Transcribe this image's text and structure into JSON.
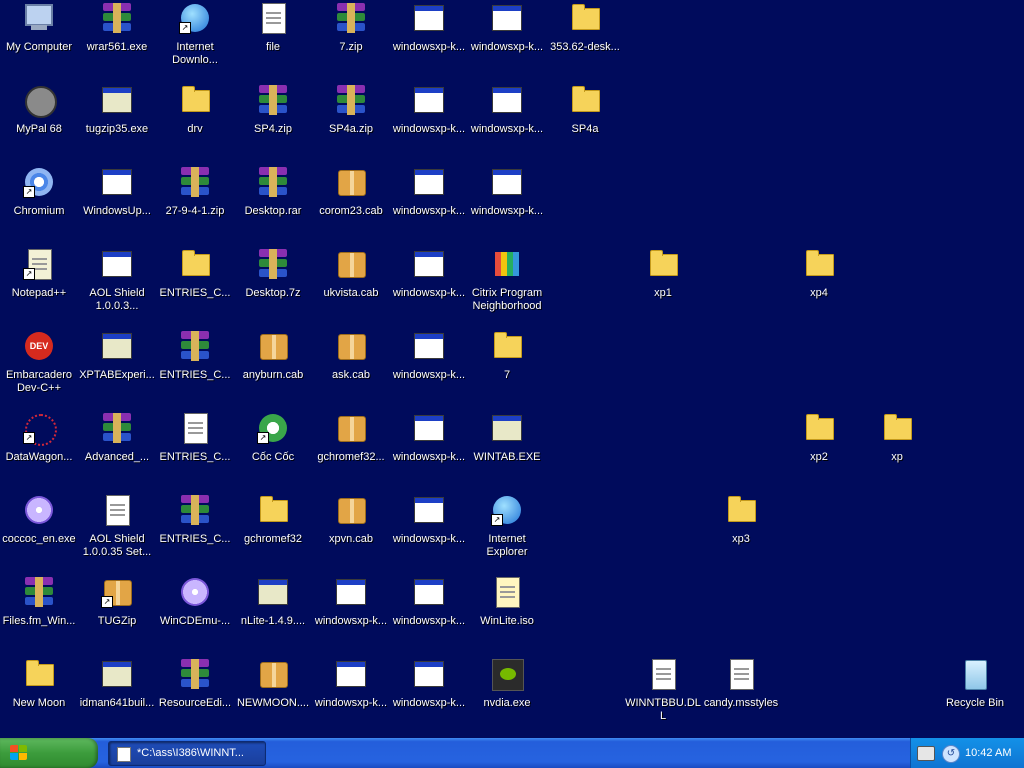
{
  "colors": {
    "desktop_bg": "#000b5c",
    "taskbar": "#245edb",
    "start_green": "#3c9c3c"
  },
  "icons": [
    {
      "label": "My Computer",
      "type": "computer",
      "col": 0,
      "row": 0
    },
    {
      "label": "wrar561.exe",
      "type": "rar",
      "col": 1,
      "row": 0
    },
    {
      "label": "Internet Downlo...",
      "type": "globe",
      "col": 2,
      "row": 0,
      "shortcut": true
    },
    {
      "label": "file",
      "type": "doc",
      "col": 3,
      "row": 0
    },
    {
      "label": "7.zip",
      "type": "rar",
      "col": 4,
      "row": 0
    },
    {
      "label": "windowsxp-k...",
      "type": "window",
      "col": 5,
      "row": 0
    },
    {
      "label": "windowsxp-k...",
      "type": "window",
      "col": 6,
      "row": 0
    },
    {
      "label": "353.62-desk...",
      "type": "folder",
      "col": 7,
      "row": 0
    },
    {
      "label": "MyPal 68",
      "type": "raccoon",
      "col": 0,
      "row": 1
    },
    {
      "label": "tugzip35.exe",
      "type": "setup",
      "col": 1,
      "row": 1
    },
    {
      "label": "drv",
      "type": "folder",
      "col": 2,
      "row": 1
    },
    {
      "label": "SP4.zip",
      "type": "rar",
      "col": 3,
      "row": 1
    },
    {
      "label": "SP4a.zip",
      "type": "rar",
      "col": 4,
      "row": 1
    },
    {
      "label": "windowsxp-k...",
      "type": "window",
      "col": 5,
      "row": 1
    },
    {
      "label": "windowsxp-k...",
      "type": "window",
      "col": 6,
      "row": 1
    },
    {
      "label": "SP4a",
      "type": "folder",
      "col": 7,
      "row": 1
    },
    {
      "label": "Chromium",
      "type": "chromium",
      "col": 0,
      "row": 2,
      "shortcut": true
    },
    {
      "label": "WindowsUp...",
      "type": "window",
      "col": 1,
      "row": 2
    },
    {
      "label": "27-9-4-1.zip",
      "type": "rar",
      "col": 2,
      "row": 2
    },
    {
      "label": "Desktop.rar",
      "type": "rar",
      "col": 3,
      "row": 2
    },
    {
      "label": "corom23.cab",
      "type": "cab",
      "col": 4,
      "row": 2
    },
    {
      "label": "windowsxp-k...",
      "type": "window",
      "col": 5,
      "row": 2
    },
    {
      "label": "windowsxp-k...",
      "type": "window",
      "col": 6,
      "row": 2
    },
    {
      "label": "Notepad++",
      "type": "notepad",
      "col": 0,
      "row": 3,
      "shortcut": true
    },
    {
      "label": "AOL Shield 1.0.0.3...",
      "type": "window",
      "col": 1,
      "row": 3
    },
    {
      "label": "ENTRIES_C...",
      "type": "folder",
      "col": 2,
      "row": 3
    },
    {
      "label": "Desktop.7z",
      "type": "rar",
      "col": 3,
      "row": 3
    },
    {
      "label": "ukvista.cab",
      "type": "cab",
      "col": 4,
      "row": 3
    },
    {
      "label": "windowsxp-k...",
      "type": "window",
      "col": 5,
      "row": 3
    },
    {
      "label": "Citrix Program Neighborhood",
      "type": "citrix",
      "col": 6,
      "row": 3
    },
    {
      "label": "xp1",
      "type": "folder",
      "col": 8,
      "row": 3
    },
    {
      "label": "xp4",
      "type": "folder",
      "col": 10,
      "row": 3
    },
    {
      "label": "Embarcadero Dev-C++",
      "type": "devcpp",
      "col": 0,
      "row": 4
    },
    {
      "label": "XPTABExperi...",
      "type": "setup",
      "col": 1,
      "row": 4
    },
    {
      "label": "ENTRIES_C...",
      "type": "rar",
      "col": 2,
      "row": 4
    },
    {
      "label": "anyburn.cab",
      "type": "cab",
      "col": 3,
      "row": 4
    },
    {
      "label": "ask.cab",
      "type": "cab",
      "col": 4,
      "row": 4
    },
    {
      "label": "windowsxp-k...",
      "type": "window",
      "col": 5,
      "row": 4
    },
    {
      "label": "7",
      "type": "folder",
      "col": 6,
      "row": 4
    },
    {
      "label": "DataWagon...",
      "type": "datawagon",
      "col": 0,
      "row": 5,
      "shortcut": true
    },
    {
      "label": "Advanced_...",
      "type": "rar",
      "col": 1,
      "row": 5
    },
    {
      "label": "ENTRIES_C...",
      "type": "doc",
      "col": 2,
      "row": 5
    },
    {
      "label": "Cốc Cốc",
      "type": "coccoc",
      "col": 3,
      "row": 5,
      "shortcut": true
    },
    {
      "label": "gchromef32...",
      "type": "cab",
      "col": 4,
      "row": 5
    },
    {
      "label": "windowsxp-k...",
      "type": "window",
      "col": 5,
      "row": 5
    },
    {
      "label": "WINTAB.EXE",
      "type": "setup",
      "col": 6,
      "row": 5
    },
    {
      "label": "xp2",
      "type": "folder",
      "col": 10,
      "row": 5
    },
    {
      "label": "xp",
      "type": "folder",
      "col": 11,
      "row": 5
    },
    {
      "label": "coccoc_en.exe",
      "type": "cd",
      "col": 0,
      "row": 6
    },
    {
      "label": "AOL Shield 1.0.0.35 Set...",
      "type": "doc",
      "col": 1,
      "row": 6
    },
    {
      "label": "ENTRIES_C...",
      "type": "rar",
      "col": 2,
      "row": 6
    },
    {
      "label": "gchromef32",
      "type": "folder",
      "col": 3,
      "row": 6
    },
    {
      "label": "xpvn.cab",
      "type": "cab",
      "col": 4,
      "row": 6
    },
    {
      "label": "windowsxp-k...",
      "type": "window",
      "col": 5,
      "row": 6
    },
    {
      "label": "Internet Explorer",
      "type": "ie",
      "col": 6,
      "row": 6,
      "shortcut": true
    },
    {
      "label": "xp3",
      "type": "folder",
      "col": 9,
      "row": 6
    },
    {
      "label": "Files.fm_Win...",
      "type": "rar",
      "col": 0,
      "row": 7
    },
    {
      "label": "TUGZip",
      "type": "cab",
      "col": 1,
      "row": 7,
      "shortcut": true
    },
    {
      "label": "WinCDEmu-...",
      "type": "cdemu",
      "col": 2,
      "row": 7
    },
    {
      "label": "nLite-1.4.9....",
      "type": "setup",
      "col": 3,
      "row": 7
    },
    {
      "label": "windowsxp-k...",
      "type": "window",
      "col": 4,
      "row": 7
    },
    {
      "label": "windowsxp-k...",
      "type": "window",
      "col": 5,
      "row": 7
    },
    {
      "label": "WinLite.iso",
      "type": "iso",
      "col": 6,
      "row": 7
    },
    {
      "label": "New Moon",
      "type": "folder",
      "col": 0,
      "row": 8
    },
    {
      "label": "idman641buil...",
      "type": "setup",
      "col": 1,
      "row": 8
    },
    {
      "label": "ResourceEdi...",
      "type": "rar",
      "col": 2,
      "row": 8
    },
    {
      "label": "NEWMOON....",
      "type": "cab",
      "col": 3,
      "row": 8
    },
    {
      "label": "windowsxp-k...",
      "type": "window",
      "col": 4,
      "row": 8
    },
    {
      "label": "windowsxp-k...",
      "type": "window",
      "col": 5,
      "row": 8
    },
    {
      "label": "nvdia.exe",
      "type": "nvidia",
      "col": 6,
      "row": 8
    },
    {
      "label": "WINNTBBU.DLL",
      "type": "dll",
      "col": 8,
      "row": 8
    },
    {
      "label": "candy.msstyles",
      "type": "msstyles",
      "col": 9,
      "row": 8
    },
    {
      "label": "Recycle Bin",
      "type": "recycle",
      "col": 12,
      "row": 8
    }
  ],
  "taskbar": {
    "start_label": "",
    "task_label": "*C:\\ass\\I386\\WINNT...",
    "clock": "10:42 AM"
  }
}
